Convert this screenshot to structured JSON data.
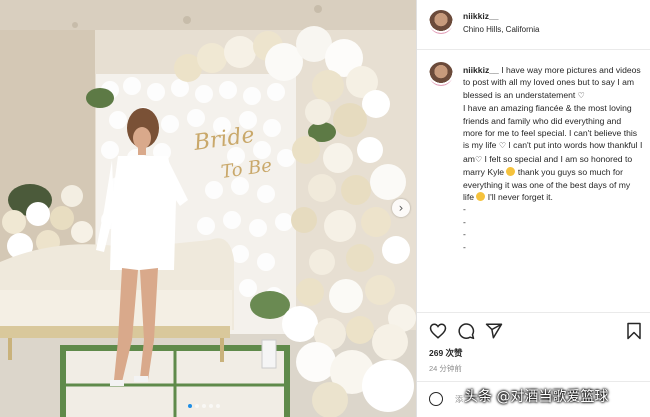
{
  "post": {
    "username": "niikkiz__",
    "location": "Chino Hills, California"
  },
  "caption": {
    "username": "niikkiz__",
    "line1": "I have way more pictures and videos to post with all my loved ones but to say I am blessed is an understatement",
    "line2": "I have an amazing fiancée & the most loving friends and family who did everything and more for me to feel special. I can't believe this is my life",
    "line3a": "I can't put into words how thankful I am",
    "line3b": "I felt so special and I am so honored to marry Kyle",
    "line3c": "thank you guys so much for everything it was one of the best days of my life",
    "line3d": "I'll never forget it.",
    "dashes": [
      "-",
      "-",
      "-",
      "-"
    ]
  },
  "photo": {
    "sign_text": "Bride To Be"
  },
  "stats": {
    "likes": "269 次赞",
    "time": "24 分钟前"
  },
  "comment": {
    "placeholder": "添"
  },
  "watermark": "头条 @对酒当歌爱篮球",
  "icons": [
    "heart-icon",
    "comment-icon",
    "share-icon",
    "bookmark-icon",
    "emoji-icon",
    "chevron-right-icon"
  ],
  "colors": {
    "accent": "#1f8fe6",
    "text": "#262626",
    "muted": "#8e8e8e"
  }
}
